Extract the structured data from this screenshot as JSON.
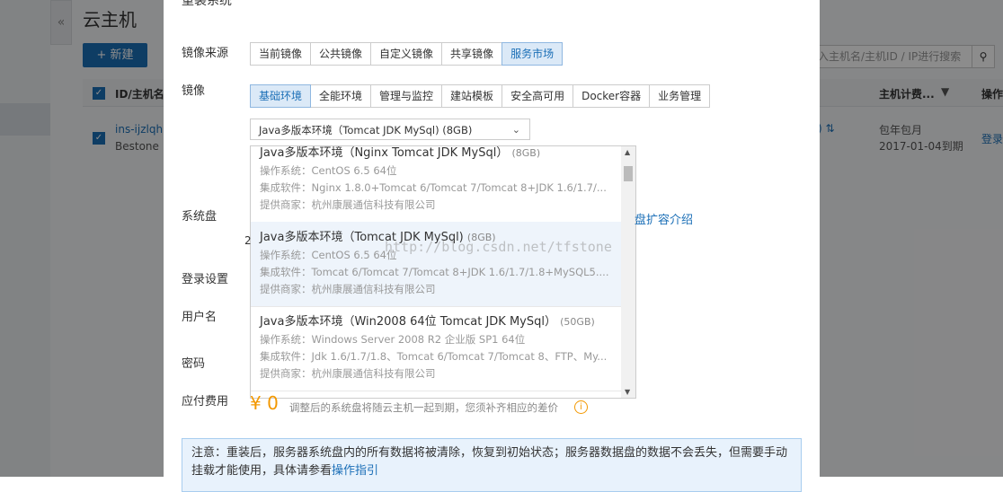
{
  "background": {
    "title": "云主机",
    "new_button": "+ 新建",
    "search_placeholder": "入主机名/主机ID / IP进行搜索",
    "collapse_glyph": "«",
    "table": {
      "col_id": "ID/主机名",
      "col_billing": "主机计费...",
      "col_action": "操作",
      "row": {
        "id": "ins-ijzlqhn",
        "name": "Bestone",
        "billing": "包年包月",
        "expire": "2017-01-04到期",
        "action": "登录",
        "tail": ") ⇅"
      }
    }
  },
  "modal": {
    "title": "重装系统",
    "image_source_label": "镜像来源",
    "image_source_tabs": [
      "当前镜像",
      "公共镜像",
      "自定义镜像",
      "共享镜像",
      "服务市场"
    ],
    "image_source_active": 4,
    "image_label": "镜像",
    "category_tabs": [
      "基础环境",
      "全能环境",
      "管理与监控",
      "建站模板",
      "安全高可用",
      "Docker容器",
      "业务管理"
    ],
    "category_active": 0,
    "selected_image": "Java多版本环境（Tomcat JDK MySql) (8GB)",
    "options": [
      {
        "title": "Java多版本环境（Nginx Tomcat JDK MySql）",
        "size": "(8GB)",
        "os": "操作系统：CentOS 6.5 64位",
        "software": "集成软件：Nginx 1.8.0+Tomcat 6/Tomcat 7/Tomcat 8+JDK 1.6/1.7/...",
        "vendor": "提供商家：杭州康展通信科技有限公司"
      },
      {
        "title": "Java多版本环境（Tomcat JDK MySql)",
        "size": "(8GB)",
        "os": "操作系统：CentOS 6.5 64位",
        "software": "集成软件：Tomcat 6/Tomcat 7/Tomcat 8+JDK 1.6/1.7/1.8+MySQL5....",
        "vendor": "提供商家：杭州康展通信科技有限公司"
      },
      {
        "title": "Java多版本环境（Win2008 64位 Tomcat JDK MySql）",
        "size": "(50GB)",
        "os": "操作系统：Windows Server 2008 R2 企业版 SP1 64位",
        "software": "集成软件：Jdk 1.6/1.7/1.8、Tomcat 6/Tomcat 7/Tomcat 8、FTP、My...",
        "vendor": "提供商家：杭州康展通信科技有限公司"
      }
    ],
    "selected_option": 1,
    "system_disk_label": "系统盘",
    "system_disk_value": "2",
    "expand_link": "盘扩容介绍",
    "login_label": "登录设置",
    "username_label": "用户名",
    "password_label": "密码",
    "fee_label": "应付费用",
    "fee_value": "¥ 0",
    "fee_note": "调整后的系统盘将随云主机一起到期，您须补齐相应的差价",
    "notice_text": "注意：重装后，服务器系统盘内的所有数据将被清除，恢复到初始状态；服务器数据盘的数据不会丢失，但需要手动挂载才能使用，具体请参看",
    "notice_link": "操作指引"
  },
  "watermark": "http://blog.csdn.net/tfstone"
}
